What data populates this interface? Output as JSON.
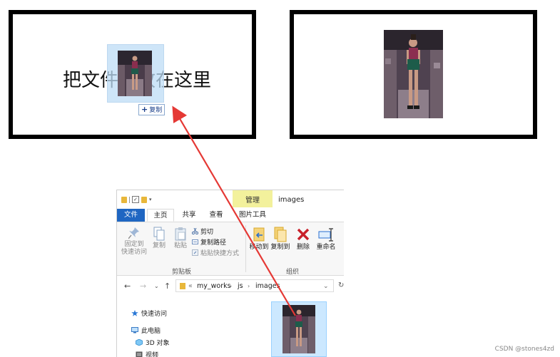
{
  "dropzone": {
    "text": "把文件拖放在这里",
    "copy_hint": "复制",
    "copy_plus": "+"
  },
  "explorer": {
    "context_tab": "管理",
    "window_title": "images",
    "tabs": [
      "文件",
      "主页",
      "共享",
      "查看",
      "图片工具"
    ],
    "ribbon": {
      "pin_label_1": "固定到",
      "pin_label_2": "快速访问",
      "copy": "复制",
      "paste": "粘贴",
      "cut": "剪切",
      "copy_path": "复制路径",
      "paste_shortcut": "粘贴快捷方式",
      "clipboard_group": "剪贴板",
      "move_to": "移动到",
      "copy_to": "复制到",
      "delete": "删除",
      "rename": "重命名",
      "organize_group": "组织"
    },
    "address": {
      "prefix": "«",
      "segments": [
        "my_works",
        "js",
        "images"
      ]
    },
    "nav_pane": {
      "quick_access": "快速访问",
      "this_pc": "此电脑",
      "objects_3d": "3D 对象",
      "videos": "视频"
    }
  },
  "watermark": "CSDN @stones4zd",
  "colors": {
    "file_tab": "#1f66c2",
    "context_tab": "#f3f19c",
    "arrow": "#e53935",
    "selection": "#cce8ff"
  },
  "icons": {
    "pin": "pin-icon",
    "cut": "scissors-icon",
    "delete": "red-x-icon"
  }
}
